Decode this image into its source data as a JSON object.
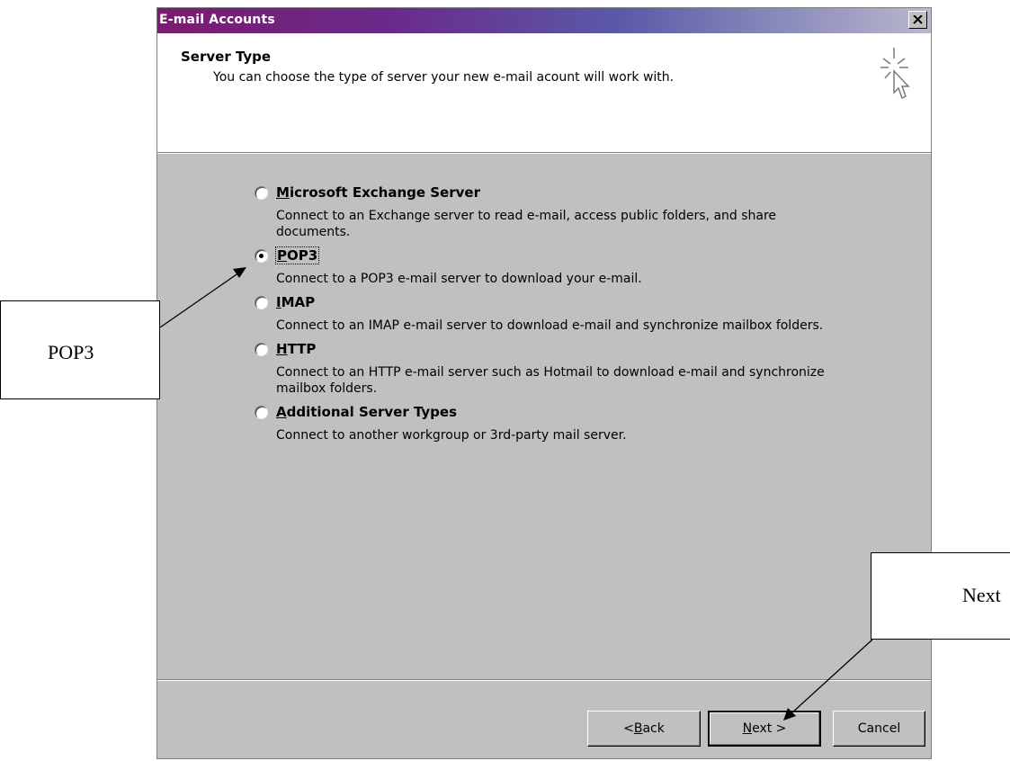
{
  "window": {
    "title": "E-mail Accounts"
  },
  "header": {
    "title": "Server Type",
    "subtitle": "You can choose the type of server your new e-mail acount will work with."
  },
  "options": [
    {
      "label": "Microsoft Exchange Server",
      "mnemonic": "M",
      "rest": "icrosoft Exchange Server",
      "description": "Connect to an Exchange server to read e-mail, access public folders, and share documents.",
      "selected": false
    },
    {
      "label": "POP3",
      "mnemonic": "P",
      "rest": "OP3",
      "description": "Connect to a POP3 e-mail server to download your e-mail.",
      "selected": true
    },
    {
      "label": "IMAP",
      "mnemonic": "I",
      "rest": "MAP",
      "description": "Connect to an IMAP e-mail server to download e-mail and synchronize mailbox folders.",
      "selected": false
    },
    {
      "label": "HTTP",
      "mnemonic": "H",
      "rest": "TTP",
      "description": "Connect to an HTTP e-mail server such as Hotmail to download e-mail and synchronize mailbox folders.",
      "selected": false
    },
    {
      "label": "Additional Server Types",
      "mnemonic": "A",
      "rest": "dditional Server Types",
      "description": "Connect to another workgroup or 3rd-party mail server.",
      "selected": false
    }
  ],
  "buttons": {
    "back_pre": "< ",
    "back_mnemonic": "B",
    "back_rest": "ack",
    "next_mnemonic": "N",
    "next_rest": "ext >",
    "cancel": "Cancel"
  },
  "callouts": {
    "pop3": "POP3",
    "next": "Next"
  },
  "icons": {
    "close": "close-icon",
    "wizard": "wizard-cursor-icon"
  },
  "colors": {
    "title_gradient_start": "#7a1b70",
    "title_gradient_end": "#b8b8ce",
    "dialog_bg": "#c0c0c0"
  }
}
